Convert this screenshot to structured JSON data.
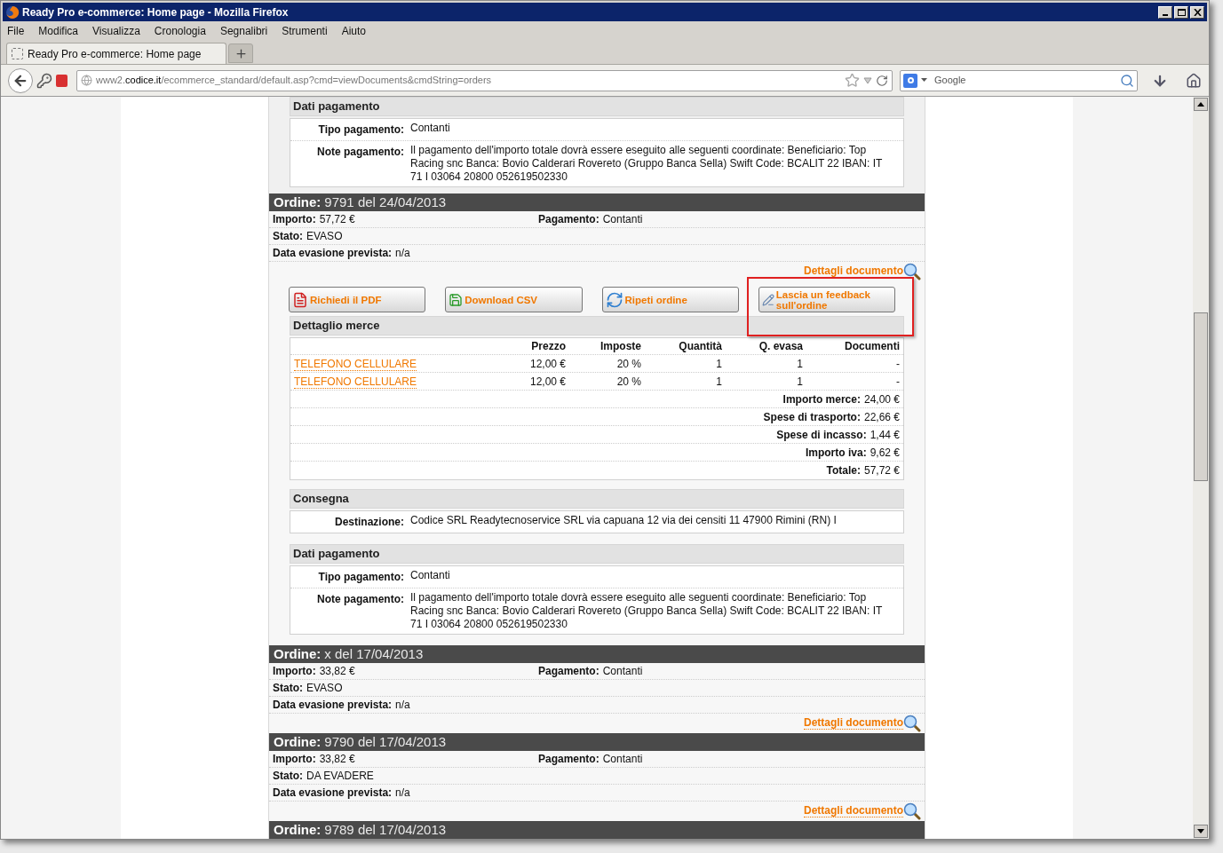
{
  "window": {
    "title": "Ready Pro e-commerce: Home page - Mozilla Firefox"
  },
  "menu": [
    "File",
    "Modifica",
    "Visualizza",
    "Cronologia",
    "Segnalibri",
    "Strumenti",
    "Aiuto"
  ],
  "tabs": [
    {
      "label": "Ready Pro e-commerce: Home page",
      "selected": true
    }
  ],
  "address": {
    "prefix": "www2.",
    "domain": "codice.it",
    "path": "/ecommerce_standard/default.asp?cmd=viewDocuments&cmdString=orders"
  },
  "search": {
    "placeholder": "Google"
  },
  "previous_payment": {
    "heading": "Dati pagamento",
    "rows": [
      {
        "label": "Tipo pagamento:",
        "value": "Contanti"
      },
      {
        "label": "Note pagamento:",
        "value": "Il pagamento dell'importo totale dovrà essere eseguito alle seguenti coordinate: Beneficiario: Top Racing snc Banca: Bovio Calderari Rovereto (Gruppo Banca Sella) Swift Code: BCALIT 22 IBAN: IT 71 I 03064 20800 052619502330"
      }
    ]
  },
  "orders": [
    {
      "label": "Ordine:",
      "title": "9791 del 24/04/2013",
      "fields": [
        {
          "label": "Importo:",
          "value": "57,72 €"
        },
        {
          "label": "Pagamento:",
          "value": "Contanti"
        },
        {
          "label": "Stato:",
          "value": "EVASO"
        },
        {
          "label": "Data evasione prevista:",
          "value": "n/a"
        }
      ],
      "details_link": "Dettagli documento",
      "actions": [
        {
          "kind": "pdf",
          "label": "Richiedi il PDF",
          "highlighted": false
        },
        {
          "kind": "csv",
          "label": "Download CSV",
          "highlighted": false
        },
        {
          "kind": "repeat",
          "label": "Ripeti ordine",
          "highlighted": false
        },
        {
          "kind": "feedback",
          "label": "Lascia un feedback sull'ordine",
          "highlighted": true
        }
      ],
      "goods": {
        "heading": "Dettaglio merce",
        "columns": [
          "Prezzo",
          "Imposte",
          "Quantità",
          "Q. evasa",
          "Documenti"
        ],
        "rows": [
          {
            "product": "TELEFONO CELLULARE",
            "cells": [
              "12,00 €",
              "20 %",
              "1",
              "1",
              "-"
            ]
          },
          {
            "product": "TELEFONO CELLULARE",
            "cells": [
              "12,00 €",
              "20 %",
              "1",
              "1",
              "-"
            ]
          }
        ],
        "totals": [
          {
            "label": "Importo merce:",
            "value": "24,00 €"
          },
          {
            "label": "Spese di trasporto:",
            "value": "22,66 €"
          },
          {
            "label": "Spese di incasso:",
            "value": "1,44 €"
          },
          {
            "label": "Importo iva:",
            "value": "9,62 €"
          },
          {
            "label": "Totale:",
            "value": "57,72 €"
          }
        ]
      },
      "delivery": {
        "heading": "Consegna",
        "rows": [
          {
            "label": "Destinazione:",
            "value": "Codice SRL Readytecnoservice SRL via capuana 12 via dei censiti 11 47900 Rimini (RN) I"
          }
        ]
      },
      "payment": {
        "heading": "Dati pagamento",
        "rows": [
          {
            "label": "Tipo pagamento:",
            "value": "Contanti"
          },
          {
            "label": "Note pagamento:",
            "value": "Il pagamento dell'importo totale dovrà essere eseguito alle seguenti coordinate: Beneficiario: Top Racing snc Banca: Bovio Calderari Rovereto (Gruppo Banca Sella) Swift Code: BCALIT 22 IBAN: IT 71 I 03064 20800 052619502330"
          }
        ]
      }
    },
    {
      "label": "Ordine:",
      "title": "x del 17/04/2013",
      "fields": [
        {
          "label": "Importo:",
          "value": "33,82 €"
        },
        {
          "label": "Pagamento:",
          "value": "Contanti"
        },
        {
          "label": "Stato:",
          "value": "EVASO"
        },
        {
          "label": "Data evasione prevista:",
          "value": "n/a"
        }
      ],
      "details_link": "Dettagli documento"
    },
    {
      "label": "Ordine:",
      "title": "9790 del 17/04/2013",
      "fields": [
        {
          "label": "Importo:",
          "value": "33,82 €"
        },
        {
          "label": "Pagamento:",
          "value": "Contanti"
        },
        {
          "label": "Stato:",
          "value": "DA EVADERE"
        },
        {
          "label": "Data evasione prevista:",
          "value": "n/a"
        }
      ],
      "details_link": "Dettagli documento"
    },
    {
      "label": "Ordine:",
      "title": "9789 del 17/04/2013"
    }
  ]
}
